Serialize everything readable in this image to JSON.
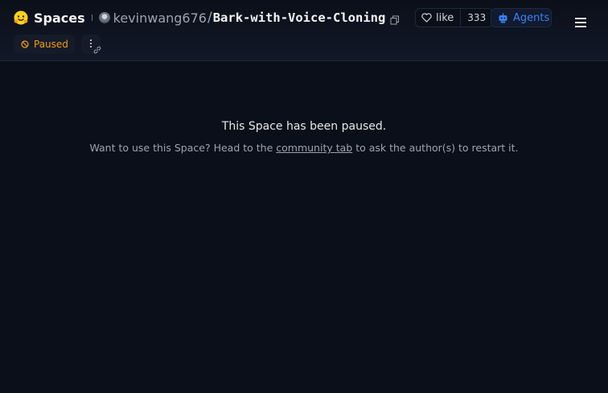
{
  "header": {
    "section_label": "Spaces",
    "owner": "kevinwang676",
    "separator": "/",
    "repo_name": "Bark-with-Voice-Cloning",
    "like_label": "like",
    "like_count": "333",
    "agents_label": "Agents",
    "status_label": "Paused"
  },
  "icons": {
    "logo": "hugging-face-logo",
    "copy": "copy-icon",
    "like": "heart-icon",
    "agents": "robot-icon",
    "menu": "hamburger-menu-icon",
    "paused": "paused-icon",
    "more": "more-vertical-icon",
    "link": "link-icon"
  },
  "main": {
    "title": "This Space has been paused.",
    "sub_before": "Want to use this Space? Head to the ",
    "sub_link": "community tab",
    "sub_after": " to ask the author(s) to restart it."
  },
  "colors": {
    "background": "#0b0f19",
    "paused_accent": "#f59e0b",
    "agents_accent": "#3b82f6"
  }
}
